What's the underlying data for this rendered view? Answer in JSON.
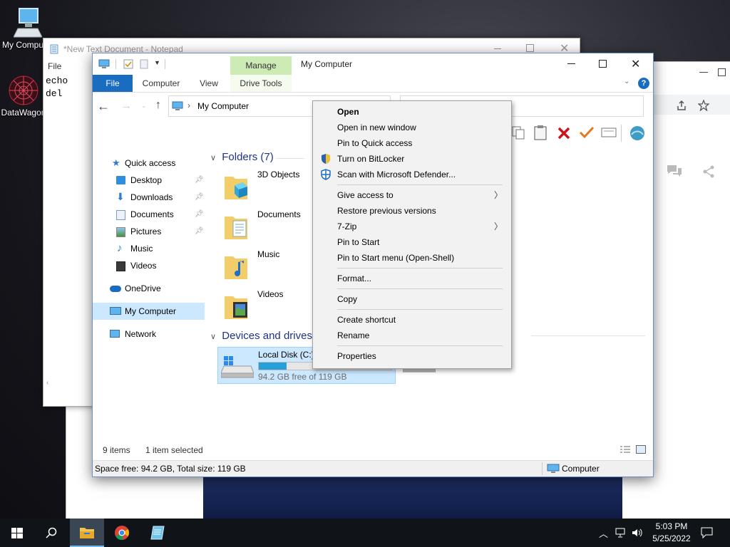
{
  "desktop": {
    "icons": [
      {
        "label": "My Computer"
      },
      {
        "label": "DataWagon"
      }
    ]
  },
  "notepad": {
    "title": "*New Text Document - Notepad",
    "menu_file": "File",
    "lines": [
      "echo",
      "del"
    ]
  },
  "explorer": {
    "qat_manage": "Manage",
    "window_title": "My Computer",
    "tabs": [
      "File",
      "Computer",
      "View",
      "Drive Tools"
    ],
    "address": "My Computer",
    "nav": [
      {
        "label": "Quick access"
      },
      {
        "label": "Desktop"
      },
      {
        "label": "Downloads"
      },
      {
        "label": "Documents"
      },
      {
        "label": "Pictures"
      },
      {
        "label": "Music"
      },
      {
        "label": "Videos"
      },
      {
        "label": "OneDrive"
      },
      {
        "label": "My Computer"
      },
      {
        "label": "Network"
      }
    ],
    "folders_header": "Folders (7)",
    "folders": [
      "3D Objects",
      "Documents",
      "Music",
      "Videos"
    ],
    "devices_header": "Devices and drives",
    "drive": {
      "name": "Local Disk (C:)",
      "free": "94.2 GB free of 119 GB",
      "used_fraction": 0.21
    },
    "status_items": "9 items",
    "status_selected": "1 item selected",
    "bottom_left": "Space free: 94.2 GB, Total size: 119 GB",
    "bottom_right": "Computer"
  },
  "context_menu": {
    "items": [
      {
        "label": "Open"
      },
      {
        "label": "Open in new window"
      },
      {
        "label": "Pin to Quick access"
      },
      {
        "label": "Turn on BitLocker"
      },
      {
        "label": "Scan with Microsoft Defender..."
      },
      {
        "label": "Give access to"
      },
      {
        "label": "Restore previous versions"
      },
      {
        "label": "7-Zip"
      },
      {
        "label": "Pin to Start"
      },
      {
        "label": "Pin to Start menu (Open-Shell)"
      },
      {
        "label": "Format..."
      },
      {
        "label": "Copy"
      },
      {
        "label": "Create shortcut"
      },
      {
        "label": "Rename"
      },
      {
        "label": "Properties"
      }
    ]
  },
  "taskbar": {
    "time": "5:03 PM",
    "date": "5/25/2022"
  },
  "colors": {
    "accent": "#0063b1",
    "manage_tab": "#cdebb5",
    "selection": "#cce8ff",
    "drive_bar": "#26a0da"
  }
}
